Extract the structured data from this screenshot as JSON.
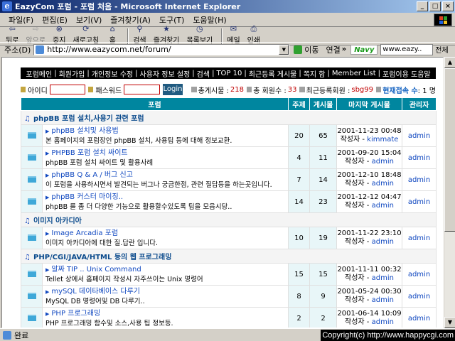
{
  "window": {
    "title": "EazyCom 포럼 - 포럼 처음 - Microsoft Internet Explorer",
    "minimize": "_",
    "maximize": "□",
    "close": "×"
  },
  "menu": [
    "파일(F)",
    "편집(E)",
    "보기(V)",
    "즐겨찾기(A)",
    "도구(T)",
    "도움말(H)"
  ],
  "toolbar": {
    "back": "뒤로",
    "forward": "앞으로",
    "stop": "중지",
    "refresh": "새로고침",
    "home": "홈",
    "search": "검색",
    "favorites": "즐겨찾기",
    "history": "목록보기",
    "mail": "메일",
    "print": "인쇄"
  },
  "address": {
    "label": "주소(D)",
    "url": "http://www.eazycom.net/forum/",
    "go": "이동",
    "links": "연결",
    "links_chevron": "»",
    "naver": "Navy",
    "naver_value": "www.eazy..",
    "naver_btn": "전체"
  },
  "navbar": [
    "포럼메인",
    "회원가입",
    "개인정보 수정",
    "사용자 정보 설정",
    "검색",
    "TOP 10",
    "최근등록 게시물",
    "쪽지 함",
    "Member List",
    "포럼이용 도움말"
  ],
  "nav_sep": "|",
  "login": {
    "id_label": "아이디",
    "pw_label": "패스워드",
    "button": "Login",
    "total_posts_label": "총게시물 :",
    "total_posts": "218",
    "total_members_label": "총 회원수 :",
    "total_members": "33",
    "recent_member_label": "최근등록회원 :",
    "recent_member": "sbg99",
    "online_label": "현재접속 수",
    "online_value": ": 1 명"
  },
  "table_headers": {
    "forum": "포럼",
    "topics": "주제",
    "posts": "게시물",
    "last_post": "마지막 게시물",
    "moderator": "관리자"
  },
  "categories": [
    {
      "name": "phpBB 포럼 설치,사용기 관련 포럼",
      "forums": [
        {
          "title": "phpBB 설치및 사용법",
          "desc": "본 홈페이지의 포럼장인 phpBB 설치, 사용팁 등에 대해 정보교환.",
          "topics": "20",
          "posts": "65",
          "date": "2001-11-23 00:48",
          "author_label": "작성자 - ",
          "author": "kimmate",
          "mod": "admin"
        },
        {
          "title": "PHPBB 포럼 설치 싸이트",
          "desc": "phpBB 포럼 설치 싸이트 및 활용사례",
          "topics": "4",
          "posts": "11",
          "date": "2001-09-20 15:04",
          "author_label": "작성자 - ",
          "author": "admin",
          "mod": "admin"
        },
        {
          "title": "phpBB Q & A / 버그 신고",
          "desc": "이 포럼을 사용하시면서 발견되는 버그나 궁금한점, 관련 질답등을 하는곳입니다.",
          "topics": "7",
          "posts": "14",
          "date": "2001-12-10 18:48",
          "author_label": "작성자 - ",
          "author": "admin",
          "mod": "admin"
        },
        {
          "title": "phpBB 커스터 마이징..",
          "desc": "phpBB 를 좀 더 다양한 기능으로 활용할수있도록 팁을 모읍시당..",
          "topics": "14",
          "posts": "23",
          "date": "2001-12-12 04:47",
          "author_label": "작성자 - ",
          "author": "admin",
          "mod": "admin"
        }
      ]
    },
    {
      "name": "이미지 아카디아",
      "forums": [
        {
          "title": "Image Arcadia 포럼",
          "desc": "이미지 아카디아에 대한 질.답란 입니다.",
          "topics": "10",
          "posts": "19",
          "date": "2001-11-22 23:10",
          "author_label": "작성자 - ",
          "author": "admin",
          "mod": "admin"
        }
      ]
    },
    {
      "name": "PHP/CGI/JAVA/HTML 등의 웹 프로그래밍",
      "forums": [
        {
          "title": "알짜 TIP .. Unix Command",
          "desc": "Tellet 상에서 홈페이지 작성시 자주쓰이는 Unix 명령어",
          "topics": "15",
          "posts": "15",
          "date": "2001-11-11 00:32",
          "author_label": "작성자 - ",
          "author": "admin",
          "mod": "admin"
        },
        {
          "title": "mySQL 데이타베이스 다루기",
          "desc": "MySQL DB 명령어및 DB 다루기..",
          "topics": "8",
          "posts": "9",
          "date": "2001-05-24 00:30",
          "author_label": "작성자 - ",
          "author": "admin",
          "mod": "admin"
        },
        {
          "title": "PHP 프로그래밍",
          "desc": "PHP 프로그래밍 함수및 소스,사용 팁 정보등.",
          "topics": "2",
          "posts": "2",
          "date": "2001-06-14 10:09",
          "author_label": "작성자 - ",
          "author": "admin",
          "mod": "admin"
        }
      ]
    }
  ],
  "status": {
    "text": "완료",
    "copyright": "Copyright(c) http://www.happycgi.com"
  }
}
